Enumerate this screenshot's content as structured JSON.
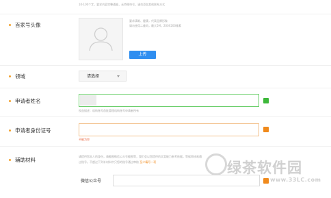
{
  "top_hint": "10-100个字，要求内容完整通顺，无特殊符号，请勿添加其他联系方式",
  "avatar": {
    "label": "百家号头像",
    "hint_1": "要求清晰、健康，代表品牌形象",
    "hint_2": "请勿使用二维码，最大5M，200X200像素",
    "upload_button": "上传"
  },
  "domain": {
    "label": "领域",
    "select_value": "请选择"
  },
  "applicant_name": {
    "label": "申请者姓名",
    "hint": "权益描述：机构账号首批管理机构账号申请者所有"
  },
  "applicant_id": {
    "label": "申请者身份证号",
    "error": "不能为空"
  },
  "aux_material": {
    "label": "辅助材料",
    "hint_line1": "请提供您本人的身份，请截图微信公众号截图等，我们会以您提供的文案能力参考依据，等候审核难通",
    "hint_line2": "过账号。不超过下列补材料中只您的账号通过审核",
    "hint_link": "至少填写一项",
    "wechat_label": "微信公众号"
  },
  "watermark": {
    "text": "绿茶软件园",
    "url": "www.33LC.com"
  },
  "colors": {
    "required_dot": "#f2a12e",
    "primary": "#2f8ef0",
    "success": "#3db83a",
    "warning": "#f08a1c"
  }
}
